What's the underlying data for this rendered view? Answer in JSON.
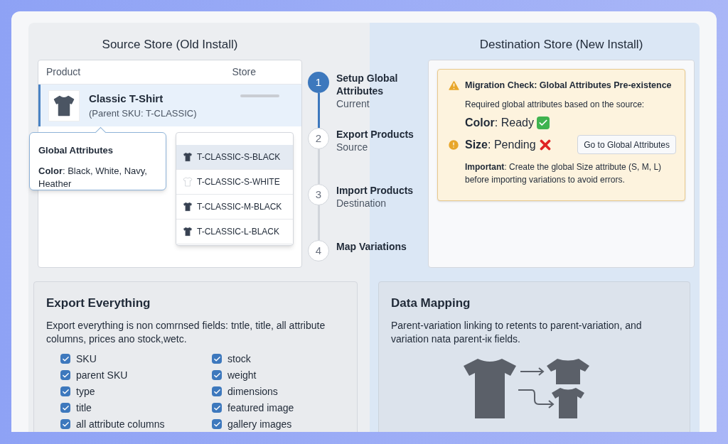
{
  "source": {
    "title": "Source Store (Old Install)",
    "columns": [
      "Product",
      "Store"
    ],
    "product": {
      "name": "Classic T-Shirt",
      "sku": "(Parent SKU: T-CLASSIC)",
      "selected": true
    },
    "tooltip": {
      "title": "Global Attributes",
      "text": "**Color**: Black, White, Navy, Heather"
    },
    "variations": [
      {
        "sku": "T-CLASSIC-S-BLACK",
        "color": "#374151",
        "selected": true
      },
      {
        "sku": "T-CLASSIC-S-WHITE",
        "color": "#ffffff",
        "selected": false
      },
      {
        "sku": "T-CLASSIC-M-BLACK",
        "color": "#374151",
        "selected": false
      },
      {
        "sku": "T-CLASSIC-L-BLACK",
        "color": "#374151",
        "selected": false
      }
    ]
  },
  "steps": [
    {
      "number": "1",
      "title": "Setup Global Attributes",
      "subtitle": "Current",
      "selected": true
    },
    {
      "number": "2",
      "title": "Export Products",
      "subtitle": "Source",
      "selected": false
    },
    {
      "number": "3",
      "title": "Import Products",
      "subtitle": "Destination",
      "selected": false
    },
    {
      "number": "4",
      "title": "Map Variations",
      "selected": false
    }
  ],
  "destination": {
    "title": "Destination Store (New Install)",
    "check": {
      "title": "Migration Check: Global Attributes Pre-existence",
      "intro": "Required global attributes based on the source:",
      "attributes": [
        {
          "text": "**Color**: Ready",
          "kind": "ready"
        },
        {
          "text": "**Size**: Pending",
          "kind": "pending"
        }
      ],
      "button": "Go to Global Attributes",
      "note": "**Important**: Create the global Size attribute (S, M, L) before importing variations to avoid errors."
    }
  },
  "export": {
    "title": "Export Everything",
    "text": "Export everything is non comrnsed fields: tntle, title, all attribute columns, prices ano stock,wetc.",
    "fields": [
      [
        {
          "label": "SKU",
          "checked": true
        },
        {
          "label": "parent SKU",
          "checked": true
        },
        {
          "label": "type",
          "checked": true
        },
        {
          "label": "title",
          "checked": true
        },
        {
          "label": "all attribute columns",
          "checked": true
        }
      ],
      [
        {
          "label": "stock",
          "checked": true
        },
        {
          "label": "weight",
          "checked": true
        },
        {
          "label": "dimensions",
          "checked": true
        },
        {
          "label": "featured image",
          "checked": true
        },
        {
          "label": "gallery images",
          "checked": true
        }
      ]
    ]
  },
  "mapping": {
    "title": "Data Mapping",
    "text": "Parent-variation linking to retents to parent-variation, and variation nata parent-iк fields."
  }
}
